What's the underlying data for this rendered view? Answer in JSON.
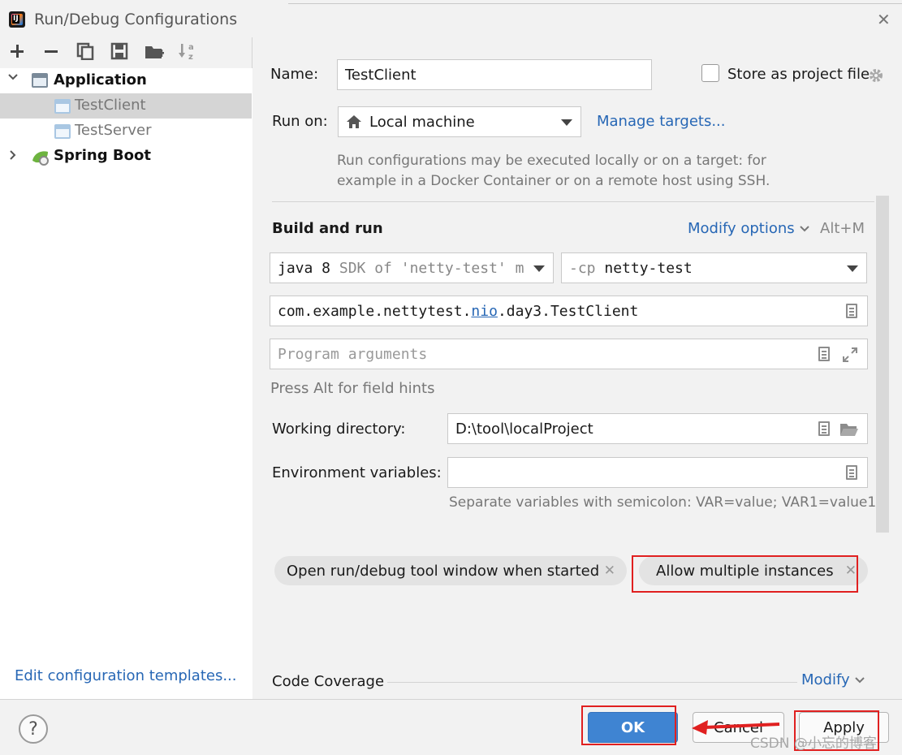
{
  "window": {
    "title": "Run/Debug Configurations",
    "close_glyph": "✕"
  },
  "toolbar": {
    "icons": [
      "add-icon",
      "remove-icon",
      "copy-icon",
      "save-icon",
      "new-folder-icon",
      "sort-icon"
    ]
  },
  "tree": {
    "groups": [
      {
        "label": "Application",
        "expanded": true,
        "children": [
          {
            "label": "TestClient",
            "selected": true
          },
          {
            "label": "TestServer",
            "selected": false
          }
        ]
      },
      {
        "label": "Spring Boot",
        "expanded": false,
        "children": []
      }
    ]
  },
  "left_footer": {
    "edit_templates": "Edit configuration templates..."
  },
  "form": {
    "name_label": "Name:",
    "name_value": "TestClient",
    "store_label": "Store as project file",
    "run_on_label": "Run on:",
    "run_on_value": "Local machine",
    "manage_targets": "Manage targets...",
    "run_on_hint_1": "Run configurations may be executed locally or on a target: for",
    "run_on_hint_2": "example in a Docker Container or on a remote host using SSH.",
    "build_run_title": "Build and run",
    "modify_options": "Modify options",
    "modify_options_shortcut": "Alt+M",
    "jre_bold": "java 8",
    "jre_hint": " SDK of 'netty-test' m",
    "cp_prefix": "-cp ",
    "cp_value": "netty-test",
    "main_class_pre": "com.example.nettytest.",
    "main_class_link": "nio",
    "main_class_post": ".day3.TestClient",
    "program_args_placeholder": "Program arguments",
    "field_hints": "Press Alt for field hints",
    "working_dir_label": "Working directory:",
    "working_dir_value": "D:\\tool\\localProject",
    "env_label": "Environment variables:",
    "env_value": "",
    "env_hint": "Separate variables with semicolon: VAR=value; VAR1=value1",
    "chips": [
      {
        "label": "Open run/debug tool window when started"
      },
      {
        "label": "Allow multiple instances"
      }
    ],
    "code_coverage": "Code Coverage",
    "modify": "Modify"
  },
  "buttons": {
    "help": "?",
    "ok": "OK",
    "cancel": "Cancel",
    "apply": "Apply"
  },
  "watermark": "CSDN @小忘的博客",
  "colors": {
    "accent": "#3f84d2",
    "link": "#2767b5",
    "highlight_box": "#e02020"
  }
}
